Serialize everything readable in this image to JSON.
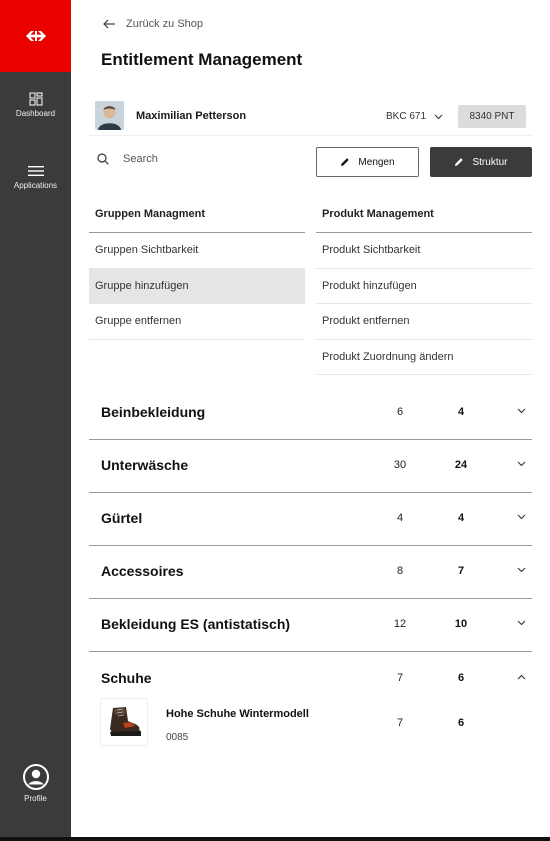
{
  "sidebar": {
    "logo": "sbb-logo-icon",
    "dashboard_label": "Dashboard",
    "applications_label": "Applications",
    "profile_label": "Profile",
    "brand_color": "#eb0000",
    "background_color": "#3b3b3b"
  },
  "header": {
    "back_label": "Zurück zu Shop",
    "title": "Entitlement Management"
  },
  "user": {
    "name": "Maximilian Petterson",
    "account": "BKC 671",
    "points": "8340 PNT"
  },
  "toolbar": {
    "search_placeholder": "Search",
    "mengen_label": "Mengen",
    "struktur_label": "Struktur"
  },
  "menus": {
    "gruppen": {
      "title": "Gruppen Managment",
      "items": [
        "Gruppen Sichtbarkeit",
        "Gruppe hinzufügen",
        "Gruppe entfernen"
      ],
      "active_index": 1
    },
    "produkt": {
      "title": "Produkt Management",
      "items": [
        "Produkt Sichtbarkeit",
        "Produkt hinzufügen",
        "Produkt entfernen",
        "Produkt Zuordnung ändern"
      ]
    }
  },
  "categories": [
    {
      "name": "Beinbekleidung",
      "a": "6",
      "b": "4",
      "expanded": false
    },
    {
      "name": "Unterwäsche",
      "a": "30",
      "b": "24",
      "expanded": false
    },
    {
      "name": "Gürtel",
      "a": "4",
      "b": "4",
      "expanded": false
    },
    {
      "name": "Accessoires",
      "a": "8",
      "b": "7",
      "expanded": false
    },
    {
      "name": "Bekleidung ES (antistatisch)",
      "a": "12",
      "b": "10",
      "expanded": false
    },
    {
      "name": "Schuhe",
      "a": "7",
      "b": "6",
      "expanded": true
    }
  ],
  "product": {
    "name": "Hohe Schuhe Wintermodell",
    "code": "0085",
    "a": "7",
    "b": "6",
    "image": "winter-boot-image"
  }
}
